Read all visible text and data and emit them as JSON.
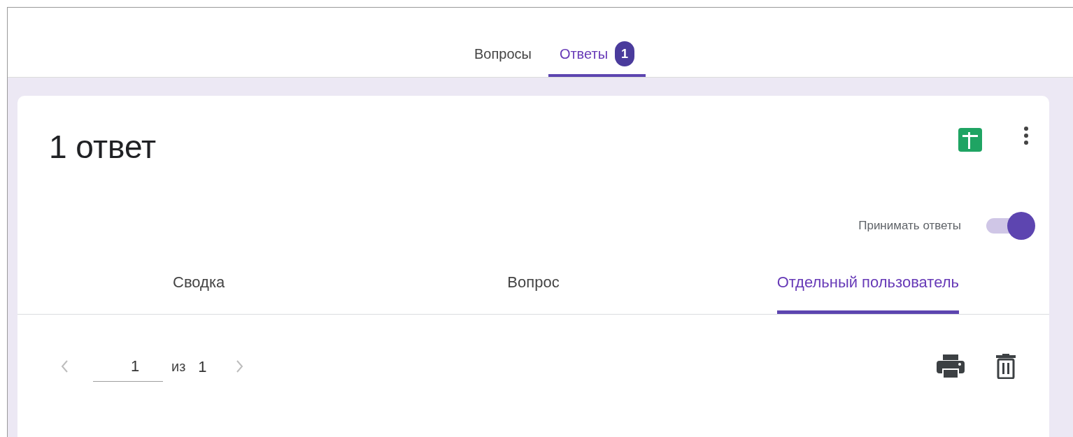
{
  "tabs": [
    {
      "label": "Вопросы",
      "selected": false
    },
    {
      "label": "Ответы",
      "selected": true,
      "badge": "1"
    }
  ],
  "summary": {
    "title": "1 ответ",
    "accept": {
      "label": "Принимать ответы",
      "on": true
    }
  },
  "view_tabs": [
    {
      "label": "Сводка",
      "selected": false
    },
    {
      "label": "Вопрос",
      "selected": false
    },
    {
      "label": "Отдельный пользователь",
      "selected": true
    }
  ],
  "pager": {
    "current": "1",
    "separator": "из",
    "total": "1"
  }
}
